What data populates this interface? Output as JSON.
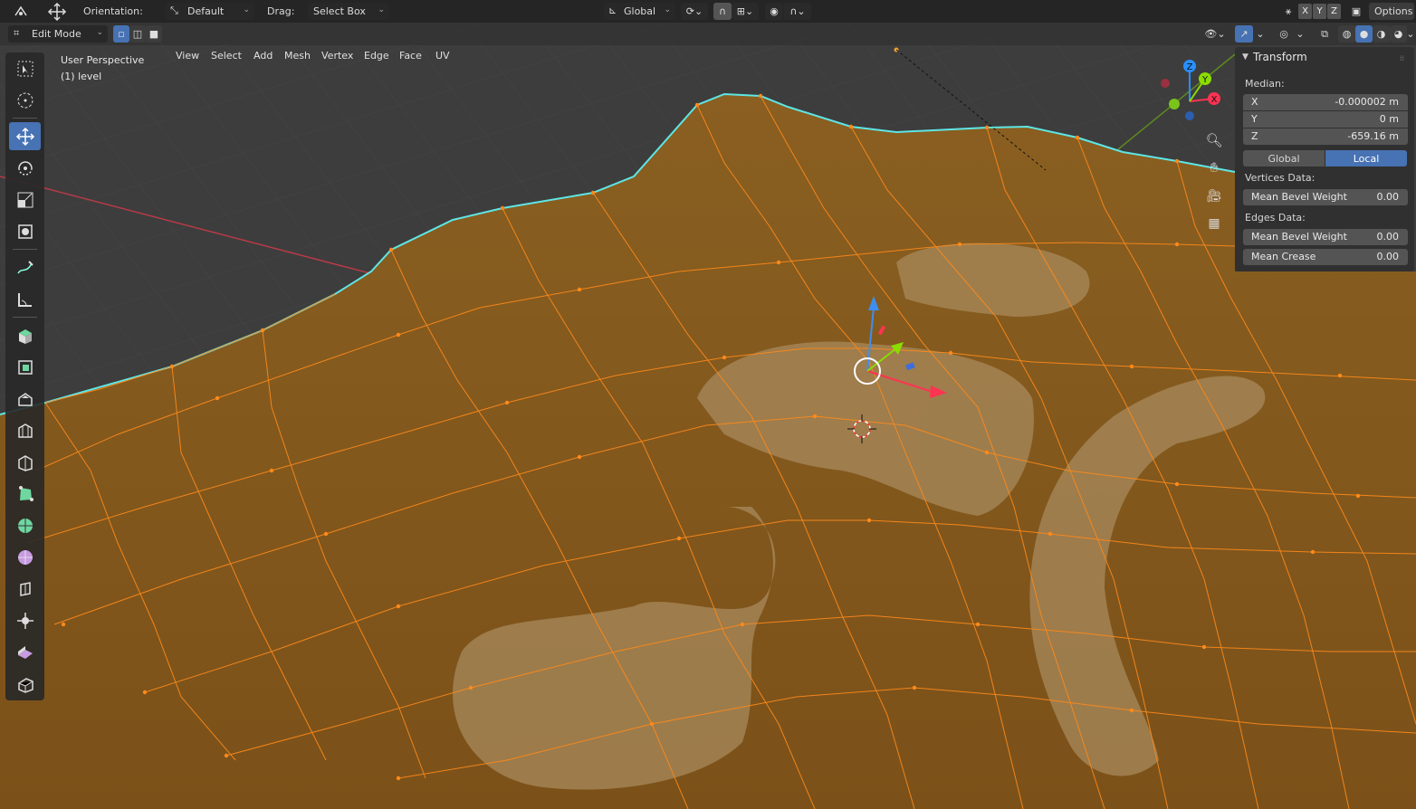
{
  "header": {
    "orientation_label": "Orientation:",
    "orientation_value": "Default",
    "drag_label": "Drag:",
    "drag_value": "Select Box",
    "transform_orientation": "Global",
    "axis_x": "X",
    "axis_y": "Y",
    "axis_z": "Z",
    "options_label": "Options"
  },
  "mode_bar": {
    "mode": "Edit Mode",
    "menus": [
      "View",
      "Select",
      "Add",
      "Mesh",
      "Vertex",
      "Edge",
      "Face",
      "UV"
    ]
  },
  "overlay": {
    "view_name": "User Perspective",
    "object_info": "(1) level"
  },
  "gizmo": {
    "x_label": "X",
    "y_label": "Y",
    "z_label": "Z"
  },
  "toolbar": {
    "tools": [
      "select-box",
      "cursor",
      "move",
      "rotate",
      "scale",
      "transform",
      "annotate",
      "measure",
      "add-cube",
      "extrude-region",
      "inset-faces",
      "bevel",
      "loop-cut",
      "knife",
      "poly-build",
      "spin",
      "smooth",
      "edge-slide",
      "shrink-fatten",
      "shear",
      "rip-region"
    ],
    "active_tool": "move"
  },
  "npanel": {
    "title": "Transform",
    "median_label": "Median:",
    "x_key": "X",
    "x_value": "-0.000002 m",
    "y_key": "Y",
    "y_value": "0 m",
    "z_key": "Z",
    "z_value": "-659.16 m",
    "global_label": "Global",
    "local_label": "Local",
    "active_space": "Local",
    "vertices_label": "Vertices Data:",
    "vert_bevel_key": "Mean Bevel Weight",
    "vert_bevel_value": "0.00",
    "edges_label": "Edges Data:",
    "edge_bevel_key": "Mean Bevel Weight",
    "edge_bevel_value": "0.00",
    "edge_crease_key": "Mean Crease",
    "edge_crease_value": "0.00"
  },
  "colors": {
    "accent": "#4772b3",
    "mesh_orange": "#ff8a1a",
    "boundary_cyan": "#5ee6e6",
    "axis_x": "#ff3352",
    "axis_y": "#8bdc00",
    "axis_z": "#2890ff"
  }
}
